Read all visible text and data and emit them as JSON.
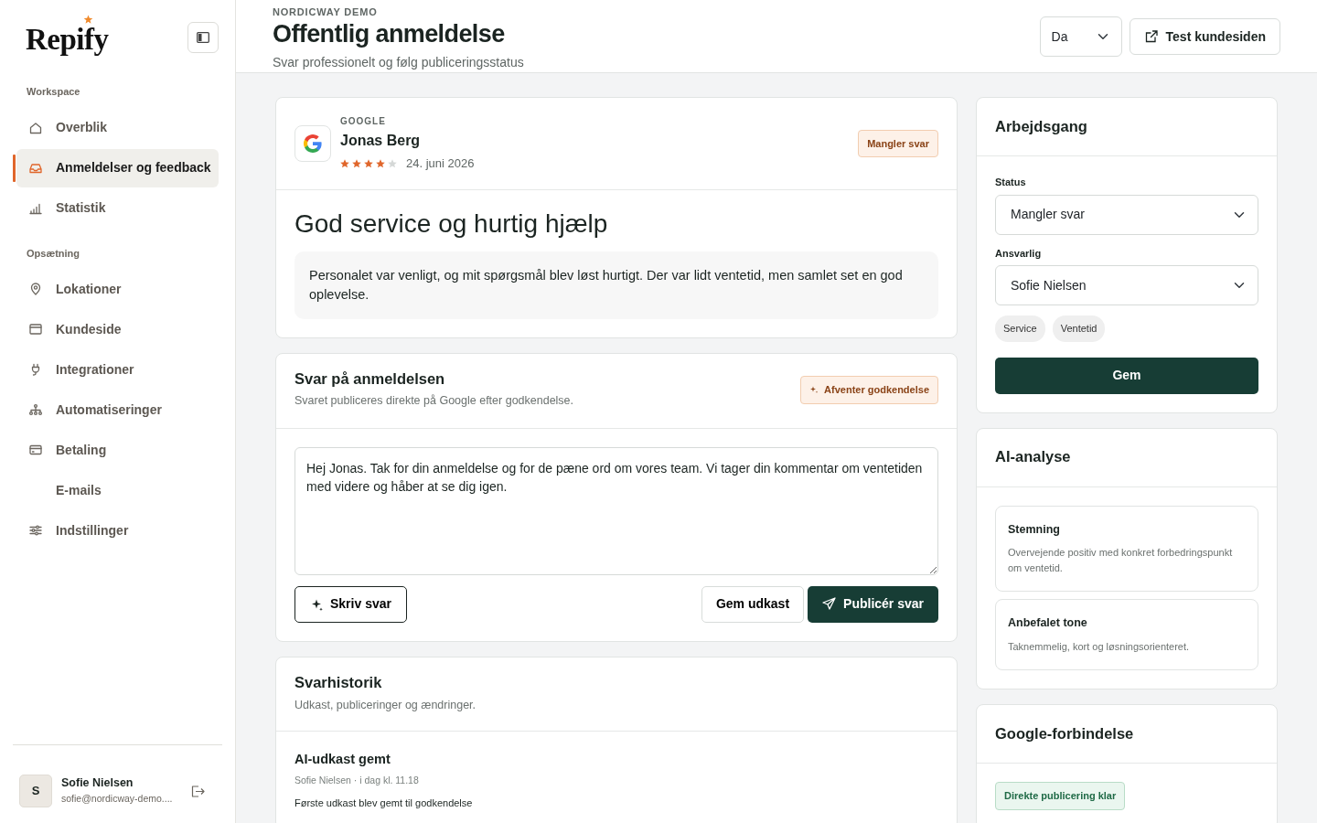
{
  "sidebar": {
    "logo": "Repify",
    "sections": [
      {
        "title": "Workspace",
        "items": [
          {
            "label": "Overblik",
            "kind": "home",
            "selected": false
          },
          {
            "label": "Anmeldelser og feedback",
            "kind": "inbox",
            "selected": true
          },
          {
            "label": "Statistik",
            "kind": "bars",
            "selected": false
          }
        ]
      },
      {
        "title": "Opsætning",
        "items": [
          {
            "label": "Lokationer",
            "kind": "pin",
            "selected": false
          },
          {
            "label": "Kundeside",
            "kind": "browser",
            "selected": false
          },
          {
            "label": "Integrationer",
            "kind": "plug",
            "selected": false
          },
          {
            "label": "Automatiseringer",
            "kind": "hierarchy",
            "selected": false
          },
          {
            "label": "Betaling",
            "kind": "card",
            "selected": false
          },
          {
            "label": "E-mails",
            "kind": "plain",
            "selected": false
          },
          {
            "label": "Indstillinger",
            "kind": "sliders",
            "selected": false
          }
        ]
      }
    ],
    "user": {
      "initial": "S",
      "name": "Sofie Nielsen",
      "email": "sofie@nordicway-demo...."
    }
  },
  "header": {
    "eyebrow": "NORDICWAY DEMO",
    "title": "Offentlig anmeldelse",
    "subtitle": "Svar professionelt og følg publiceringsstatus",
    "language": "Da",
    "test_button": "Test kundesiden"
  },
  "review": {
    "source": "GOOGLE",
    "author": "Jonas Berg",
    "stars": 4,
    "date": "24. juni 2026",
    "status_badge": "Mangler svar",
    "title": "God service og hurtig hjælp",
    "body": "Personalet var venligt, og mit spørgsmål blev løst hurtigt. Der var lidt ventetid, men samlet set en god oplevelse."
  },
  "reply": {
    "title": "Svar på anmeldelsen",
    "subtitle": "Svaret publiceres direkte på Google efter godkendelse.",
    "badge": "Afventer godkendelse",
    "text": "Hej Jonas. Tak for din anmeldelse og for de pæne ord om vores team. Vi tager din kommentar om ventetiden med videre og håber at se dig igen.",
    "write_button": "Skriv svar",
    "draft_button": "Gem udkast",
    "publish_button": "Publicér svar"
  },
  "history": {
    "title": "Svarhistorik",
    "subtitle": "Udkast, publiceringer og ændringer.",
    "entries": [
      {
        "title": "AI-udkast gemt",
        "meta": "Sofie Nielsen · i dag kl. 11.18",
        "text": "Første udkast blev gemt til godkendelse"
      }
    ]
  },
  "workflow": {
    "title": "Arbejdsgang",
    "status_label": "Status",
    "status_value": "Mangler svar",
    "owner_label": "Ansvarlig",
    "owner_value": "Sofie Nielsen",
    "tags": [
      "Service",
      "Ventetid"
    ],
    "save_button": "Gem"
  },
  "ai": {
    "title": "AI-analyse",
    "cards": [
      {
        "title": "Stemning",
        "text": "Overvejende positiv med konkret forbedringspunkt om ventetid."
      },
      {
        "title": "Anbefalet tone",
        "text": "Taknemmelig, kort og løsningsorienteret."
      }
    ]
  },
  "google": {
    "title": "Google-forbindelse",
    "badge": "Direkte publicering klar"
  }
}
